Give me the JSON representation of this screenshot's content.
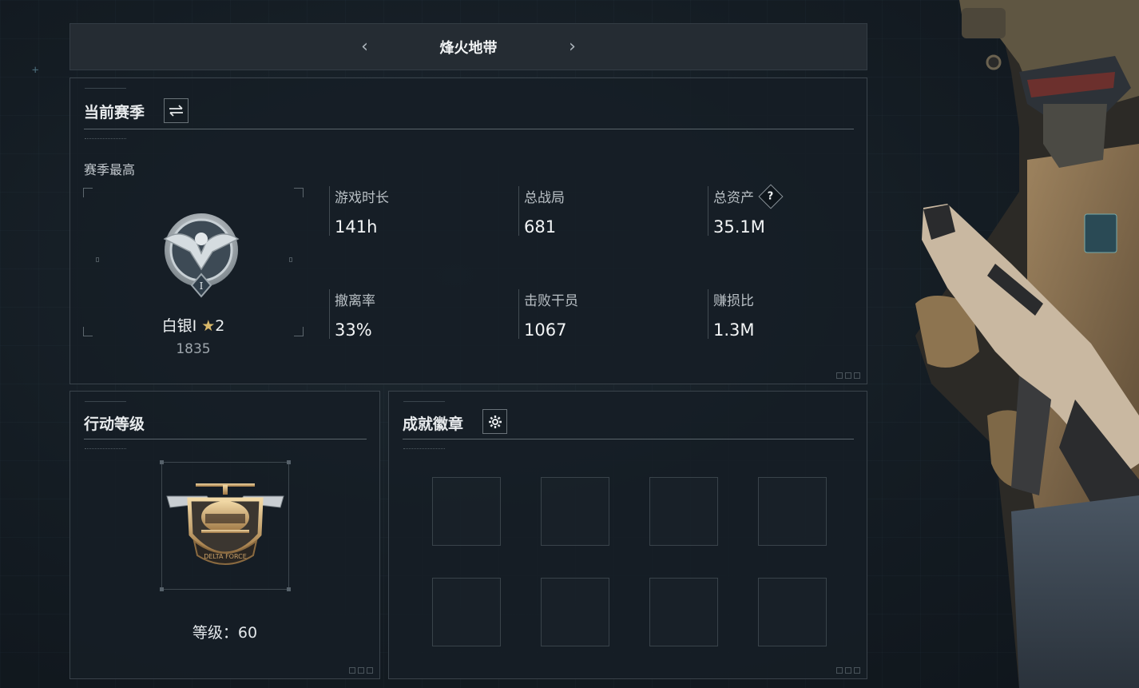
{
  "mode_switcher": {
    "title": "烽火地带",
    "prev_icon": "chevron-left-icon",
    "next_icon": "chevron-right-icon"
  },
  "current_season": {
    "title": "当前赛季",
    "switch_icon": "swap-icon",
    "season_best_label": "赛季最高",
    "rank": {
      "name": "白银I",
      "star_icon": "star-icon",
      "stars": "2",
      "score": "1835"
    },
    "stats": [
      {
        "label": "游戏时长",
        "value": "141h"
      },
      {
        "label": "总战局",
        "value": "681"
      },
      {
        "label": "总资产",
        "value": "35.1M",
        "help": "?"
      },
      {
        "label": "撤离率",
        "value": "33%"
      },
      {
        "label": "击败干员",
        "value": "1067"
      },
      {
        "label": "赚损比",
        "value": "1.3M"
      }
    ]
  },
  "action_level": {
    "title": "行动等级",
    "level_text": "等级：60",
    "emblem_text": "DELTA FORCE"
  },
  "achievements": {
    "title": "成就徽章",
    "settings_icon": "gear-icon",
    "slot_count": 8
  },
  "colors": {
    "background": "#141c23",
    "panel_border": "#3a434b",
    "rank_star": "#d8b86a",
    "emblem_gold": "#c9a067"
  }
}
